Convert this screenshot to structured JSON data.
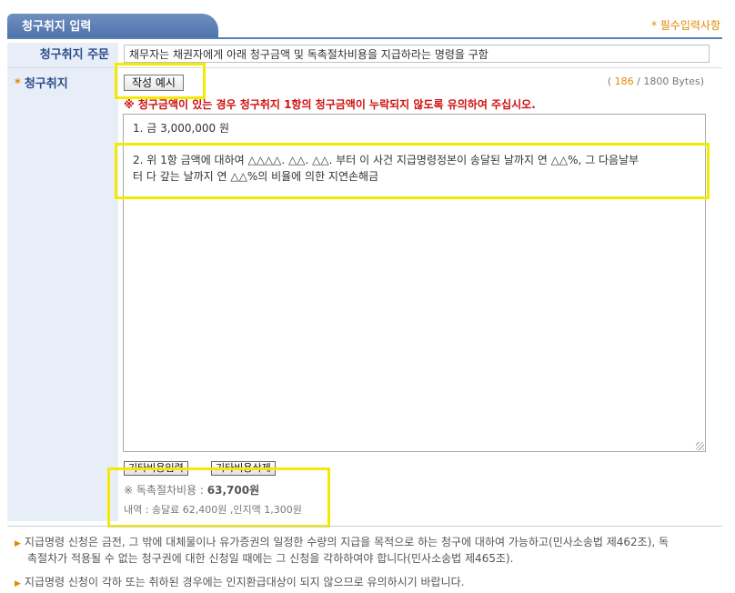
{
  "header": {
    "tab_title": "청구취지 입력",
    "required_note": "* 필수입력사항"
  },
  "order": {
    "label": "청구취지 주문",
    "value": "채무자는 채권자에게 아래 청구금액 및 독촉절차비용을 지급하라는 명령을 구함"
  },
  "claim": {
    "star": "*",
    "label": "청구취지",
    "example_button": "작성 예시",
    "bytes_open": "( ",
    "bytes_used": "186",
    "bytes_close": " / 1800 Bytes)",
    "warning": "※ 청구금액이 있는 경우 청구취지 1항의 청구금액이 누락되지 않도록 유의하여 주십시오.",
    "line1": "1. 금 3,000,000 원",
    "line2a": "2. 위 1항 금액에 대하여 △△△△. △△. △△. 부터 이 사건 지급명령정본이 송달된 날까지 연 △△%, 그 다음날부",
    "line2b": "터 다 갚는 날까지 연 △△%의 비율에 의한 지연손해금"
  },
  "buttons": {
    "other_cost_input": "기타비용입력",
    "other_cost_delete": "기타비용삭제"
  },
  "fee": {
    "label": "※ 독촉절차비용 : ",
    "amount": "63,700원",
    "detail": "내역 : 송달료 62,400원 ,인지액 1,300원"
  },
  "notes": [
    "지급명령 신청은 금전, 그 밖에 대체물이나 유가증권의 일정한 수량의 지급을 목적으로 하는 청구에 대하여 가능하고(민사소송법 제462조), 독",
    "촉절차가 적용될 수 없는 청구권에 대한 신청일 때에는 그 신청을 각하하여야 합니다(민사소송법 제465조).",
    "지급명령 신청이 각하 또는 취하된 경우에는 인지환급대상이 되지 않으므로 유의하시기 바랍니다."
  ]
}
